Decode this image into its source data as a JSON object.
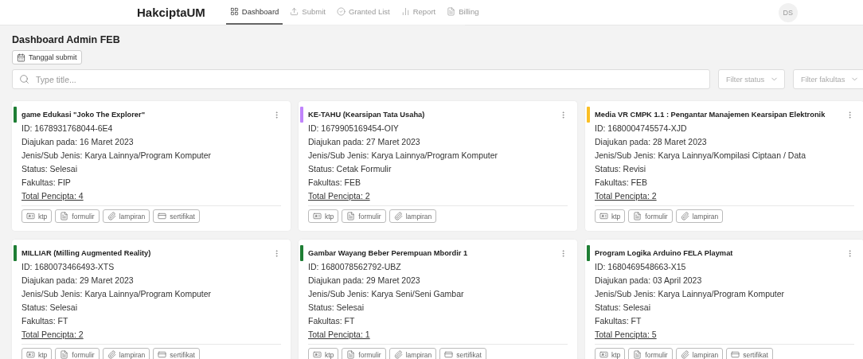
{
  "header": {
    "logo": "HakciptaUM",
    "avatar": "DS"
  },
  "nav": [
    {
      "label": "Dashboard",
      "selected": true
    },
    {
      "label": "Submit",
      "selected": false
    },
    {
      "label": "Granted List",
      "selected": false
    },
    {
      "label": "Report",
      "selected": false
    },
    {
      "label": "Billing",
      "selected": false
    }
  ],
  "page_title": "Dashboard Admin FEB",
  "date_button": "Tanggal submit",
  "search": {
    "placeholder": "Type title..."
  },
  "filters": [
    {
      "placeholder": "Filter status"
    },
    {
      "placeholder": "Filter fakultas"
    }
  ],
  "cards": [
    {
      "title": "game Edukasi \"Joko The Explorer\"",
      "color": "#1e7e34",
      "id": "ID: 1678931768044-6E4",
      "submitted": "Diajukan pada: 16 Maret 2023",
      "type": "Jenis/Sub Jenis: Karya Lainnya/Program Komputer",
      "status": "Status: Selesai",
      "faculty": "Fakultas: FIP",
      "total": "Total Pencipta: 4",
      "attachments": [
        {
          "kind": "ktp",
          "label": "ktp"
        },
        {
          "kind": "formulir",
          "label": "formulir"
        },
        {
          "kind": "lampiran",
          "label": "lampiran"
        },
        {
          "kind": "sertifikat",
          "label": "sertifikat"
        }
      ]
    },
    {
      "title": "KE-TAHU (Kearsipan Tata Usaha)",
      "color": "#c084fc",
      "id": "ID: 1679905169454-OIY",
      "submitted": "Diajukan pada: 27 Maret 2023",
      "type": "Jenis/Sub Jenis: Karya Lainnya/Program Komputer",
      "status": "Status: Cetak Formulir",
      "faculty": "Fakultas: FEB",
      "total": "Total Pencipta: 2",
      "attachments": [
        {
          "kind": "ktp",
          "label": "ktp"
        },
        {
          "kind": "formulir",
          "label": "formulir"
        },
        {
          "kind": "lampiran",
          "label": "lampiran"
        }
      ]
    },
    {
      "title": "Media VR CMPK 1.1 : Pengantar Manajemen Kearsipan Elektronik",
      "color": "#fbbf24",
      "id": "ID: 1680004745574-XJD",
      "submitted": "Diajukan pada: 28 Maret 2023",
      "type": "Jenis/Sub Jenis: Karya Lainnya/Kompilasi Ciptaan / Data",
      "status": "Status: Revisi",
      "faculty": "Fakultas: FEB",
      "total": "Total Pencipta: 2",
      "attachments": [
        {
          "kind": "ktp",
          "label": "ktp"
        },
        {
          "kind": "formulir",
          "label": "formulir"
        },
        {
          "kind": "lampiran",
          "label": "lampiran"
        }
      ]
    },
    {
      "title": "MILLIAR (Milling Augmented Reality)",
      "color": "#1e7e34",
      "id": "ID: 1680073466493-XTS",
      "submitted": "Diajukan pada: 29 Maret 2023",
      "type": "Jenis/Sub Jenis: Karya Lainnya/Program Komputer",
      "status": "Status: Selesai",
      "faculty": "Fakultas: FT",
      "total": "Total Pencipta: 2",
      "attachments": [
        {
          "kind": "ktp",
          "label": "ktp"
        },
        {
          "kind": "formulir",
          "label": "formulir"
        },
        {
          "kind": "lampiran",
          "label": "lampiran"
        },
        {
          "kind": "sertifikat",
          "label": "sertifikat"
        }
      ]
    },
    {
      "title": "Gambar Wayang Beber Perempuan Mbordir 1",
      "color": "#1e7e34",
      "id": "ID: 1680078562792-UBZ",
      "submitted": "Diajukan pada: 29 Maret 2023",
      "type": "Jenis/Sub Jenis: Karya Seni/Seni Gambar",
      "status": "Status: Selesai",
      "faculty": "Fakultas: FT",
      "total": "Total Pencipta: 1",
      "attachments": [
        {
          "kind": "ktp",
          "label": "ktp"
        },
        {
          "kind": "formulir",
          "label": "formulir"
        },
        {
          "kind": "lampiran",
          "label": "lampiran"
        },
        {
          "kind": "sertifikat",
          "label": "sertifikat"
        }
      ]
    },
    {
      "title": "Program Logika Arduino FELA Playmat",
      "color": "#1e7e34",
      "id": "ID: 1680469548663-X15",
      "submitted": "Diajukan pada: 03 April 2023",
      "type": "Jenis/Sub Jenis: Karya Lainnya/Program Komputer",
      "status": "Status: Selesai",
      "faculty": "Fakultas: FT",
      "total": "Total Pencipta: 5",
      "attachments": [
        {
          "kind": "ktp",
          "label": "ktp"
        },
        {
          "kind": "formulir",
          "label": "formulir"
        },
        {
          "kind": "lampiran",
          "label": "lampiran"
        },
        {
          "kind": "sertifikat",
          "label": "sertifikat"
        }
      ]
    }
  ]
}
